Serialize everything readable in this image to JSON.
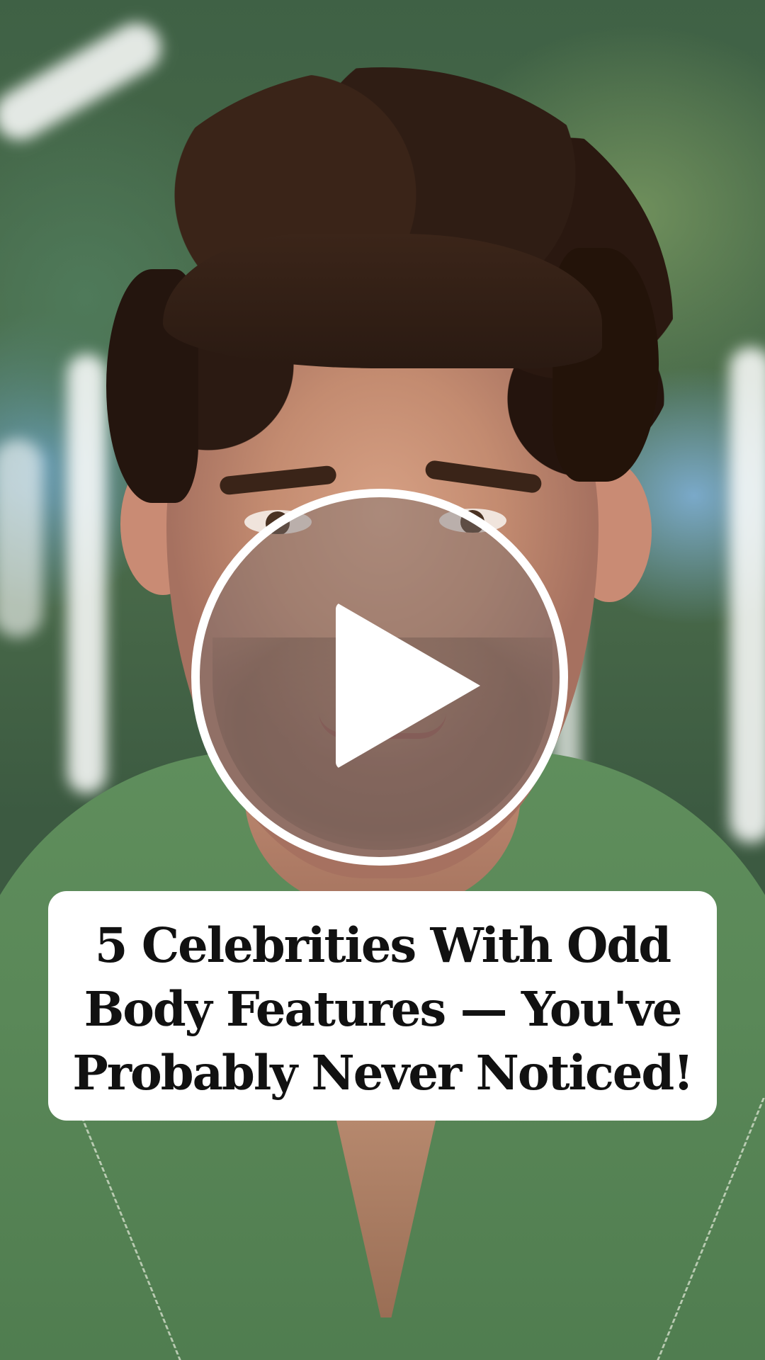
{
  "video": {
    "play_icon": "play-icon",
    "caption_lines": [
      "5 Celebrities With Odd",
      "Body Features — You've",
      "Probably Never Noticed!"
    ]
  }
}
